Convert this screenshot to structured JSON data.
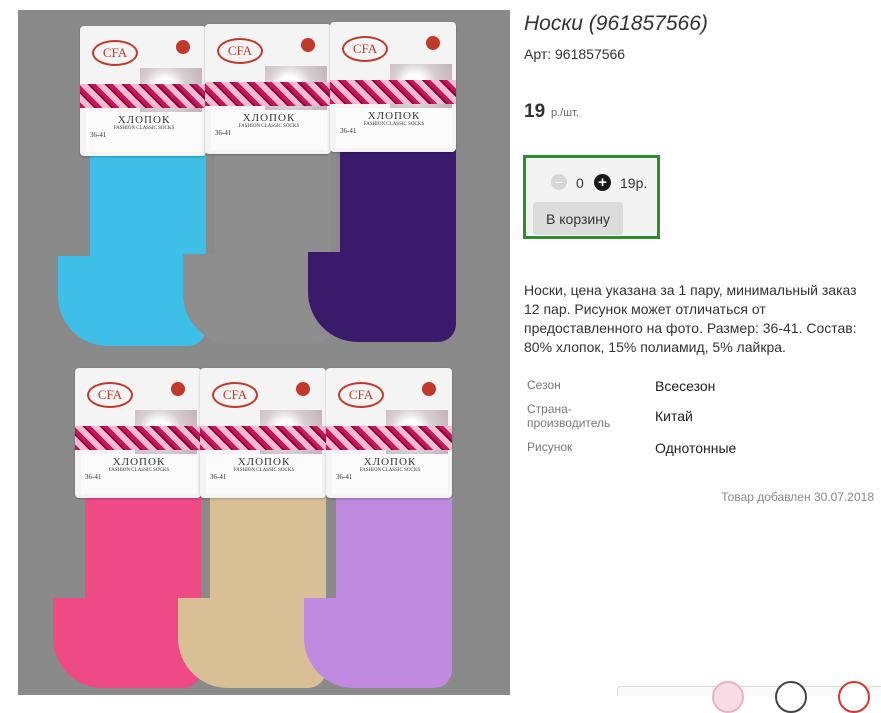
{
  "product": {
    "title": "Носки (961857566)",
    "article": "Арт: 961857566",
    "price": "19",
    "price_unit": "р./шт.",
    "description": "Носки, цена указана за 1 пару, минимальный заказ 12 пар. Рисунок может отличаться от предоставленного на фото. Размер: 36-41. Состав: 80% хлопок, 15% полиамид, 5% лайкра.",
    "added_date": "Товар добавлен 30.07.2018"
  },
  "buybox": {
    "minus_icon": "−",
    "quantity": "0",
    "plus_icon": "+",
    "sum": "19р.",
    "cart_button": "В корзину"
  },
  "properties": [
    {
      "key": "Сезон",
      "value": "Всесезон"
    },
    {
      "key": "Страна-производитель",
      "value": "Китай"
    },
    {
      "key": "Рисунок",
      "value": "Однотонные"
    }
  ],
  "photo": {
    "socks": [
      {
        "color": "#3dbfe8"
      },
      {
        "color": "#8e8e8e"
      },
      {
        "color": "#3a1a6b"
      },
      {
        "color": "#ee4a86"
      },
      {
        "color": "#d8bf96"
      },
      {
        "color": "#c08ae0"
      }
    ],
    "card_brand": "CFA",
    "card_title": "ХЛОПОК",
    "card_subtitle": "FASHION CLASSIC SOCKS",
    "card_size": "36-41"
  },
  "colors": {
    "buybox_border": "#2e8b2e",
    "button_bg": "#dcdcdc"
  }
}
